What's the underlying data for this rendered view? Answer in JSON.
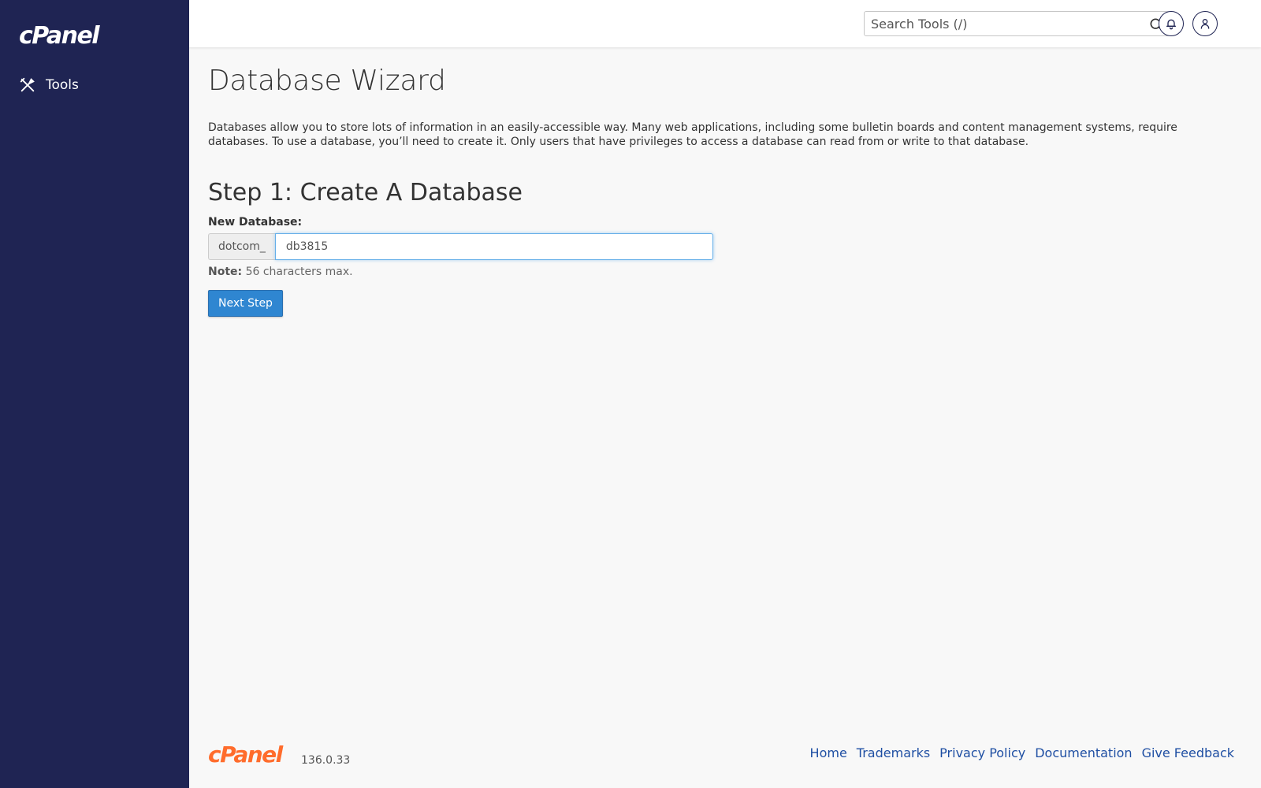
{
  "brand": {
    "logo_text": "cPanel"
  },
  "sidebar": {
    "items": [
      {
        "label": "Tools",
        "icon": "tools-icon"
      }
    ]
  },
  "topbar": {
    "search_placeholder": "Search Tools (/)",
    "icons": [
      "search-icon",
      "bell-icon",
      "user-icon"
    ]
  },
  "main": {
    "title": "Database Wizard",
    "description": "Databases allow you to store lots of information in an easily-accessible way. Many web applications, including some bulletin boards and content management systems, require databases. To use a database, you’ll need to create it. Only users that have privileges to access a database can read from or write to that database.",
    "step_title": "Step 1: Create A Database",
    "field_label": "New Database:",
    "prefix": "dotcom_",
    "db_name_value": "db3815",
    "note_label": "Note:",
    "note_text": " 56 characters max.",
    "next_button": "Next Step"
  },
  "footer": {
    "logo_text": "cPanel",
    "version": "136.0.33",
    "links": [
      "Home",
      "Trademarks",
      "Privacy Policy",
      "Documentation",
      "Give Feedback"
    ]
  },
  "colors": {
    "sidebar_bg": "#1f2453",
    "accent_orange": "#ff6c2c",
    "primary_button": "#2f86d1",
    "link": "#1f4fa3"
  }
}
